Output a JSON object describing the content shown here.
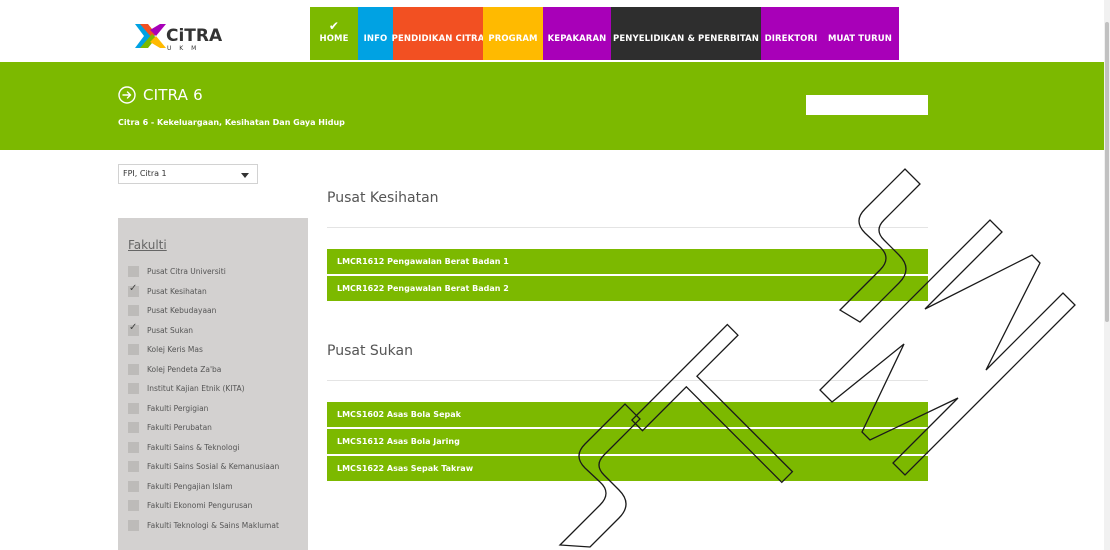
{
  "logo": {
    "text": "CiTRA",
    "subtext": "U K M"
  },
  "nav": {
    "items": [
      {
        "label": "HOME",
        "active": true
      },
      {
        "label": "INFO"
      },
      {
        "label": "PENDIDIKAN CITRA"
      },
      {
        "label": "PROGRAM"
      },
      {
        "label": "KEPAKARAN"
      },
      {
        "label": "PENYELIDIKAN & PENERBITAN"
      },
      {
        "label": "DIREKTORI"
      },
      {
        "label": "MUAT TURUN"
      }
    ],
    "active_icon": "✔"
  },
  "banner": {
    "title": "CITRA 6",
    "subtitle": "Citra 6 - Kekeluargaan, Kesihatan Dan Gaya Hidup",
    "search_value": ""
  },
  "select": {
    "value": "FPI, Citra 1"
  },
  "sidebar": {
    "title": "Fakulti",
    "items": [
      {
        "label": "Pusat Citra Universiti",
        "checked": false
      },
      {
        "label": "Pusat Kesihatan",
        "checked": true
      },
      {
        "label": "Pusat Kebudayaan",
        "checked": false
      },
      {
        "label": "Pusat Sukan",
        "checked": true
      },
      {
        "label": "Kolej Keris Mas",
        "checked": false
      },
      {
        "label": "Kolej Pendeta Za'ba",
        "checked": false
      },
      {
        "label": "Institut Kajian Etnik (KITA)",
        "checked": false
      },
      {
        "label": "Fakulti Pergigian",
        "checked": false
      },
      {
        "label": "Fakulti Perubatan",
        "checked": false
      },
      {
        "label": "Fakulti Sains & Teknologi",
        "checked": false
      },
      {
        "label": "Fakulti Sains Sosial & Kemanusiaan",
        "checked": false
      },
      {
        "label": "Fakulti Pengajian Islam",
        "checked": false
      },
      {
        "label": "Fakulti Ekonomi Pengurusan",
        "checked": false
      },
      {
        "label": "Fakulti Teknologi & Sains Maklumat",
        "checked": false
      }
    ]
  },
  "main": {
    "sections": [
      {
        "title": "Pusat Kesihatan",
        "courses": [
          "LMCR1612 Pengawalan Berat Badan 1",
          "LMCR1622 Pengawalan Berat Badan 2"
        ]
      },
      {
        "title": "Pusat Sukan",
        "courses": [
          "LMCS1602 Asas Bola Sepak",
          "LMCS1612 Asas Bola Jaring",
          "LMCS1622 Asas Sepak Takraw"
        ]
      }
    ]
  },
  "watermark": {
    "text": "UTSM"
  },
  "colors": {
    "green": "#7cb900",
    "blue": "#00a2e3",
    "orange": "#f25022",
    "yellow": "#ffba00",
    "purple": "#a800b8",
    "dark": "#2e2e2e",
    "sidebar": "#d3d1d0"
  }
}
